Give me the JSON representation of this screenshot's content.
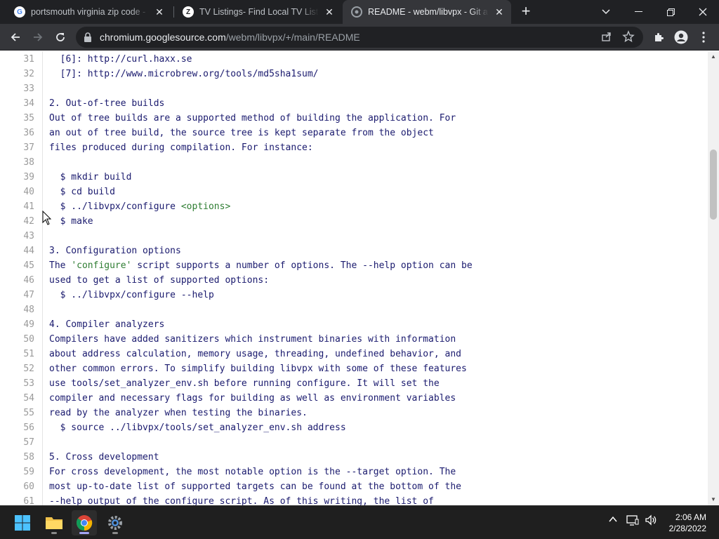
{
  "browser": {
    "tabs": [
      {
        "title": "portsmouth virginia zip code - Go",
        "favicon": "google-icon",
        "active": false
      },
      {
        "title": "TV Listings- Find Local TV Listings",
        "favicon": "z-icon",
        "active": false
      },
      {
        "title": "README - webm/libvpx - Git at Goo",
        "favicon": "google-git-icon",
        "active": true
      }
    ],
    "new_tab": "+",
    "address": {
      "host": "chromium.googlesource.com",
      "path": "/webm/libvpx/+/main/README"
    }
  },
  "document": {
    "lines": [
      {
        "n": "31",
        "text": "  [6]: http://curl.haxx.se"
      },
      {
        "n": "32",
        "text": "  [7]: http://www.microbrew.org/tools/md5sha1sum/"
      },
      {
        "n": "33",
        "text": ""
      },
      {
        "n": "34",
        "text": "2. Out-of-tree builds"
      },
      {
        "n": "35",
        "text": "Out of tree builds are a supported method of building the application. For"
      },
      {
        "n": "36",
        "text": "an out of tree build, the source tree is kept separate from the object"
      },
      {
        "n": "37",
        "text": "files produced during compilation. For instance:"
      },
      {
        "n": "38",
        "text": ""
      },
      {
        "n": "39",
        "text": "  $ mkdir build"
      },
      {
        "n": "40",
        "text": "  $ cd build"
      },
      {
        "n": "41",
        "text": "  $ ../libvpx/configure ",
        "extra": "<options>"
      },
      {
        "n": "42",
        "text": "  $ make"
      },
      {
        "n": "43",
        "text": ""
      },
      {
        "n": "44",
        "text": "3. Configuration options"
      },
      {
        "n": "45",
        "text": "The ",
        "extra": "'configure'",
        "rest": " script supports a number of options. The --help option can be"
      },
      {
        "n": "46",
        "text": "used to get a list of supported options:"
      },
      {
        "n": "47",
        "text": "  $ ../libvpx/configure --help"
      },
      {
        "n": "48",
        "text": ""
      },
      {
        "n": "49",
        "text": "4. Compiler analyzers"
      },
      {
        "n": "50",
        "text": "Compilers have added sanitizers which instrument binaries with information"
      },
      {
        "n": "51",
        "text": "about address calculation, memory usage, threading, undefined behavior, and"
      },
      {
        "n": "52",
        "text": "other common errors. To simplify building libvpx with some of these features"
      },
      {
        "n": "53",
        "text": "use tools/set_analyzer_env.sh before running configure. It will set the"
      },
      {
        "n": "54",
        "text": "compiler and necessary flags for building as well as environment variables"
      },
      {
        "n": "55",
        "text": "read by the analyzer when testing the binaries."
      },
      {
        "n": "56",
        "text": "  $ source ../libvpx/tools/set_analyzer_env.sh address"
      },
      {
        "n": "57",
        "text": ""
      },
      {
        "n": "58",
        "text": "5. Cross development"
      },
      {
        "n": "59",
        "text": "For cross development, the most notable option is the --target option. The"
      },
      {
        "n": "60",
        "text": "most up-to-date list of supported targets can be found at the bottom of the"
      },
      {
        "n": "61",
        "text": "--help output of the configure script. As of this writing, the list of"
      }
    ]
  },
  "taskbar": {
    "apps": [
      "start-icon",
      "file-explorer-icon",
      "chrome-icon",
      "settings-icon"
    ],
    "clock": {
      "time": "2:06 AM",
      "date": "2/28/2022"
    }
  },
  "colors": {
    "tab_strip": "#202124",
    "toolbar": "#35363a",
    "doc_text": "#1a1a6e",
    "doc_highlight": "#2e7d32",
    "taskbar": "#1f1f1f"
  }
}
